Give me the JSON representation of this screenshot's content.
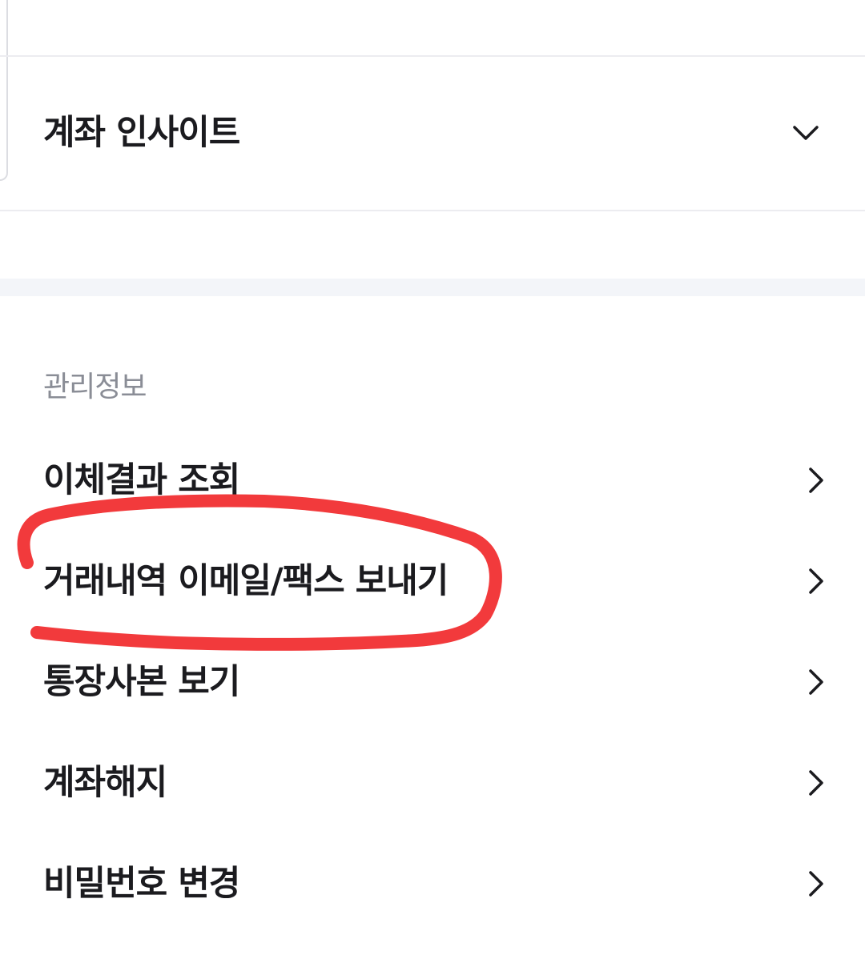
{
  "insight": {
    "title": "계좌 인사이트",
    "toggle_icon": "chevron-down-icon"
  },
  "management": {
    "section_label": "관리정보",
    "items": [
      {
        "label": "이체결과 조회",
        "icon": "chevron-right-icon"
      },
      {
        "label": "거래내역 이메일/팩스 보내기",
        "icon": "chevron-right-icon"
      },
      {
        "label": "통장사본 보기",
        "icon": "chevron-right-icon"
      },
      {
        "label": "계좌해지",
        "icon": "chevron-right-icon"
      },
      {
        "label": "비밀번호 변경",
        "icon": "chevron-right-icon"
      }
    ]
  },
  "annotation": {
    "type": "hand-drawn-circle",
    "color": "#f23a3c",
    "target": "거래내역 이메일/팩스 보내기"
  },
  "colors": {
    "text_primary": "#1b1b1f",
    "text_secondary": "#8a8d96",
    "divider": "#ececf0",
    "section_background": "#f3f5f9"
  }
}
